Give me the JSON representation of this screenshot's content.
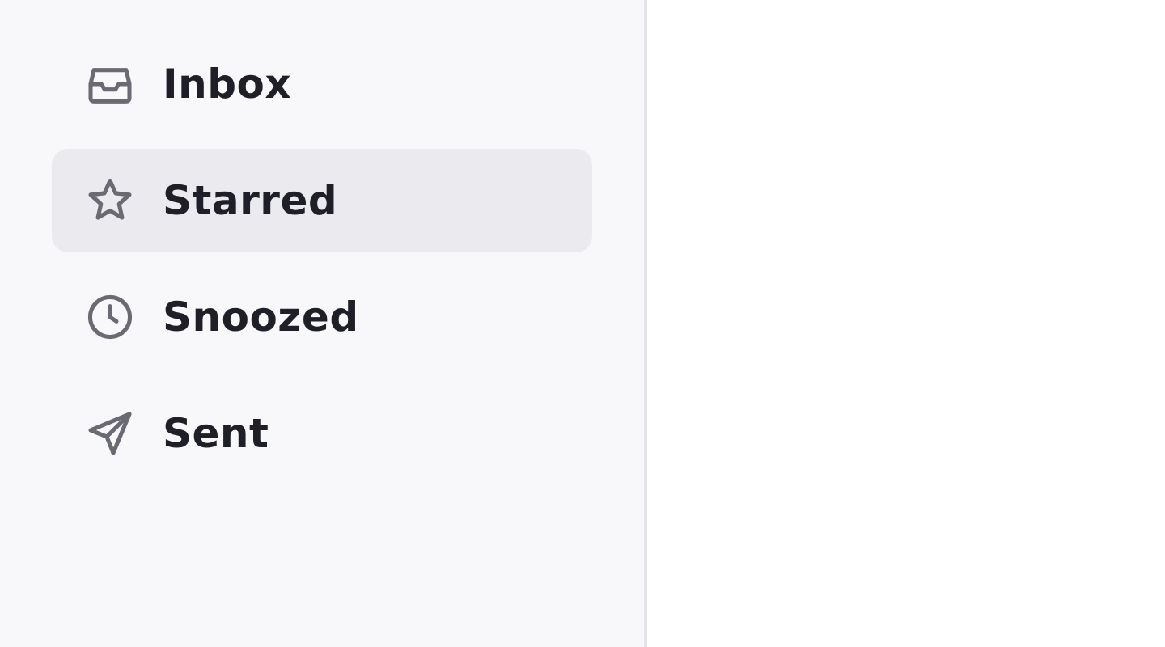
{
  "sidebar": {
    "items": [
      {
        "label": "Inbox",
        "icon": "inbox-icon",
        "active": false
      },
      {
        "label": "Starred",
        "icon": "star-icon",
        "active": true
      },
      {
        "label": "Snoozed",
        "icon": "clock-icon",
        "active": false
      },
      {
        "label": "Sent",
        "icon": "send-icon",
        "active": false
      }
    ]
  },
  "colors": {
    "sidebar_bg": "#f8f8fb",
    "active_bg": "#ebeaef",
    "text": "#1f1f27",
    "icon": "#6a6a73",
    "divider": "#e6e6ea",
    "content_bg": "#ffffff"
  }
}
